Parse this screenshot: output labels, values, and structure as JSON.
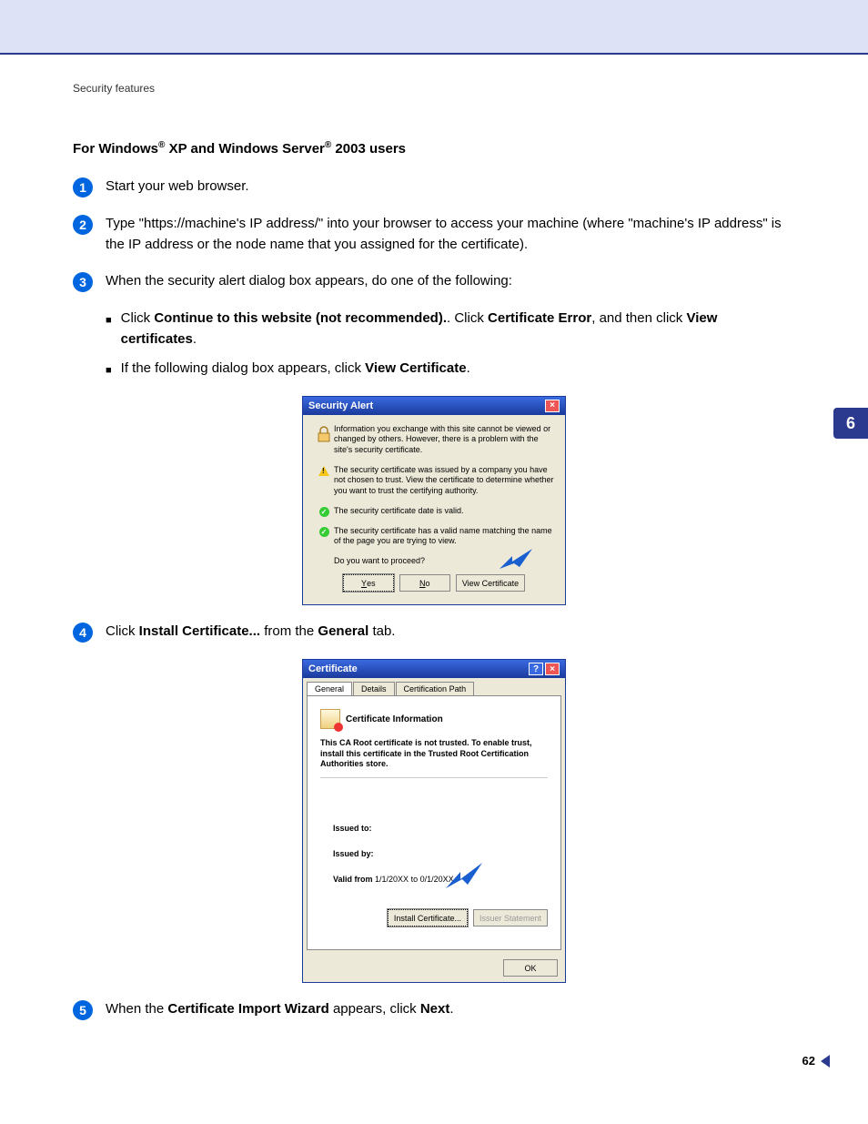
{
  "header": {
    "section": "Security features"
  },
  "subheading": {
    "p1": "For Windows",
    "reg1": "®",
    "p2": " XP and Windows Server",
    "reg2": "®",
    "p3": " 2003 users"
  },
  "steps": {
    "s1": "Start your web browser.",
    "s2": "Type \"https://machine's IP address/\" into your browser to access your machine (where \"machine's IP address\" is the IP address or the node name that you assigned for the certificate).",
    "s3_intro": "When the security alert dialog box appears, do one of the following:",
    "s3_b1_a": "Click ",
    "s3_b1_b": "Continue to this website (not recommended).",
    "s3_b1_c": ". Click ",
    "s3_b1_d": "Certificate Error",
    "s3_b1_e": ", and then click ",
    "s3_b1_f": "View certificates",
    "s3_b1_g": ".",
    "s3_b2_a": "If the following dialog box appears, click ",
    "s3_b2_b": "View Certificate",
    "s3_b2_c": ".",
    "s4_a": "Click ",
    "s4_b": "Install Certificate...",
    "s4_c": " from the ",
    "s4_d": "General",
    "s4_e": " tab.",
    "s5_a": "When the ",
    "s5_b": "Certificate Import Wizard",
    "s5_c": " appears, click ",
    "s5_d": "Next",
    "s5_e": "."
  },
  "dlg1": {
    "title": "Security Alert",
    "intro": "Information you exchange with this site cannot be viewed or changed by others. However, there is a problem with the site's security certificate.",
    "warn": "The security certificate was issued by a company you have not chosen to trust. View the certificate to determine whether you want to trust the certifying authority.",
    "ok1": "The security certificate date is valid.",
    "ok2": "The security certificate has a valid name matching the name of the page you are trying to view.",
    "proceed": "Do you want to proceed?",
    "yes": "Yes",
    "no": "No",
    "view": "View Certificate"
  },
  "dlg2": {
    "title": "Certificate",
    "tabs": {
      "general": "General",
      "details": "Details",
      "path": "Certification Path"
    },
    "heading": "Certificate Information",
    "msg": "This CA Root certificate is not trusted. To enable trust, install this certificate in the Trusted Root Certification Authorities store.",
    "issued_to_label": "Issued to:",
    "issued_by_label": "Issued by:",
    "valid_label": "Valid from",
    "valid_from": "1/1/20XX",
    "valid_to_word": "to",
    "valid_to": "0/1/20XX",
    "install": "Install Certificate...",
    "issuer_stmt": "Issuer Statement",
    "ok": "OK"
  },
  "side": {
    "chapter": "6",
    "page": "62"
  }
}
